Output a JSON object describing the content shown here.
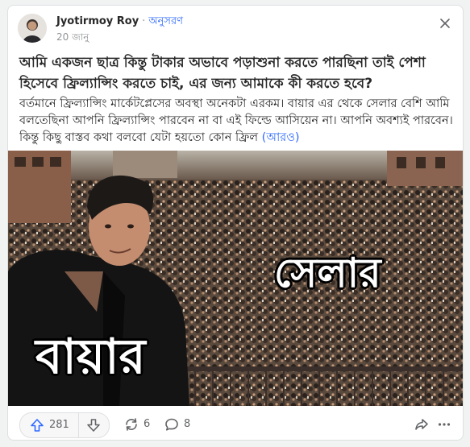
{
  "post": {
    "author_name": "Jyotirmoy Roy",
    "follow_label": "অনুসরণ",
    "date": "20 জানু",
    "question": "আমি একজন ছাত্র কিন্তু টাকার অভাবে পড়াশুনা করতে পারছিনা তাই পেশা হিসেবে ফ্রিল্যান্সিং করতে চাই, এর জন্য আমাকে কী করতে হবে?",
    "answer_preview": "বর্তমানে ফ্রিল্যান্সিং মার্কেটপ্লেসের অবস্থা অনেকটা এরকম। বায়ার এর থেকে সেলার বেশি আমি বলতেছিনা আপনি ফ্রিল্যান্সিং পারবেন না বা এই ফিল্ডে আসিয়েন না। আপনি অবশ্যই পারবেন। কিন্তু কিছু বাস্তব কথা বলবো যেটা হয়তো কোন ফ্রিল",
    "more_label": "(আরও)"
  },
  "meme": {
    "label_seller": "সেলার",
    "label_buyer": "বায়ার"
  },
  "actions": {
    "upvote_count": "281",
    "share_count": "6",
    "comment_count": "8"
  },
  "icons": {
    "close": "close-icon",
    "upvote": "upvote-arrow-icon",
    "downvote": "downvote-arrow-icon",
    "reshare": "reshare-icon",
    "comment": "comment-bubble-icon",
    "forward": "share-arrow-icon",
    "more": "more-dots-icon"
  },
  "colors": {
    "link_blue": "#2e69ff",
    "upvote_blue": "#2e69ff",
    "text_dark": "#282829",
    "text_muted": "#636466"
  }
}
